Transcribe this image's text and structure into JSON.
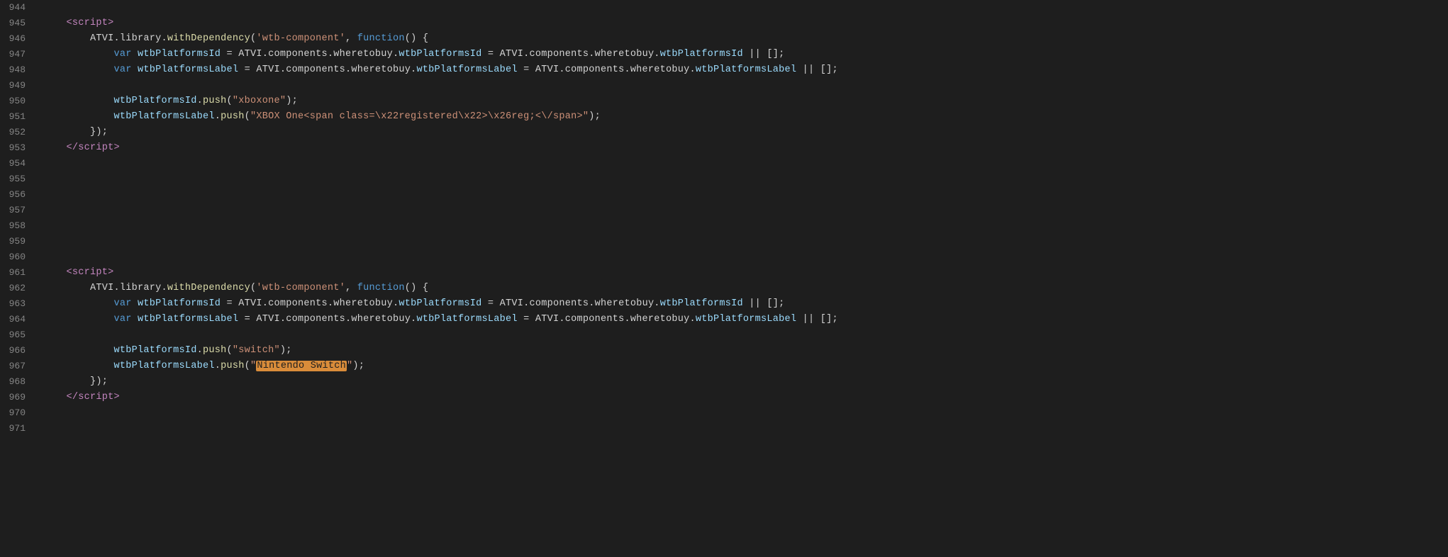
{
  "editor": {
    "background": "#1e1e1e",
    "lines": [
      {
        "num": 944,
        "content": ""
      },
      {
        "num": 945,
        "content": "    <script>"
      },
      {
        "num": 946,
        "content": "        ATVI.library.withDependency('wtb-component', function() {"
      },
      {
        "num": 947,
        "content": "            var wtbPlatformsId = ATVI.components.wheretobuy.wtbPlatformsId = ATVI.components.wheretobuy.wtbPlatformsId || [];"
      },
      {
        "num": 948,
        "content": "            var wtbPlatformsLabel = ATVI.components.wheretobuy.wtbPlatformsLabel = ATVI.components.wheretobuy.wtbPlatformsLabel || [];"
      },
      {
        "num": 949,
        "content": ""
      },
      {
        "num": 950,
        "content": "            wtbPlatformsId.push(\"xboxone\");"
      },
      {
        "num": 951,
        "content": "            wtbPlatformsLabel.push(\"XBOX One<span class=\\x22registered\\x22>\\x26reg;<\\/span>\");"
      },
      {
        "num": 952,
        "content": "        });"
      },
      {
        "num": 953,
        "content": "    <\\/script>"
      },
      {
        "num": 954,
        "content": ""
      },
      {
        "num": 955,
        "content": ""
      },
      {
        "num": 956,
        "content": ""
      },
      {
        "num": 957,
        "content": ""
      },
      {
        "num": 958,
        "content": ""
      },
      {
        "num": 959,
        "content": ""
      },
      {
        "num": 960,
        "content": ""
      },
      {
        "num": 961,
        "content": "    <script>"
      },
      {
        "num": 962,
        "content": "        ATVI.library.withDependency('wtb-component', function() {"
      },
      {
        "num": 963,
        "content": "            var wtbPlatformsId = ATVI.components.wheretobuy.wtbPlatformsId = ATVI.components.wheretobuy.wtbPlatformsId || [];"
      },
      {
        "num": 964,
        "content": "            var wtbPlatformsLabel = ATVI.components.wheretobuy.wtbPlatformsLabel = ATVI.components.wheretobuy.wtbPlatformsLabel || [];"
      },
      {
        "num": 965,
        "content": ""
      },
      {
        "num": 966,
        "content": "            wtbPlatformsId.push(\"switch\");"
      },
      {
        "num": 967,
        "content": "            wtbPlatformsLabel.push(\"Nintendo Switch\");",
        "highlight": "Nintendo Switch"
      },
      {
        "num": 968,
        "content": "        });"
      },
      {
        "num": 969,
        "content": "    <\\/script>"
      },
      {
        "num": 970,
        "content": ""
      },
      {
        "num": 971,
        "content": ""
      }
    ]
  }
}
